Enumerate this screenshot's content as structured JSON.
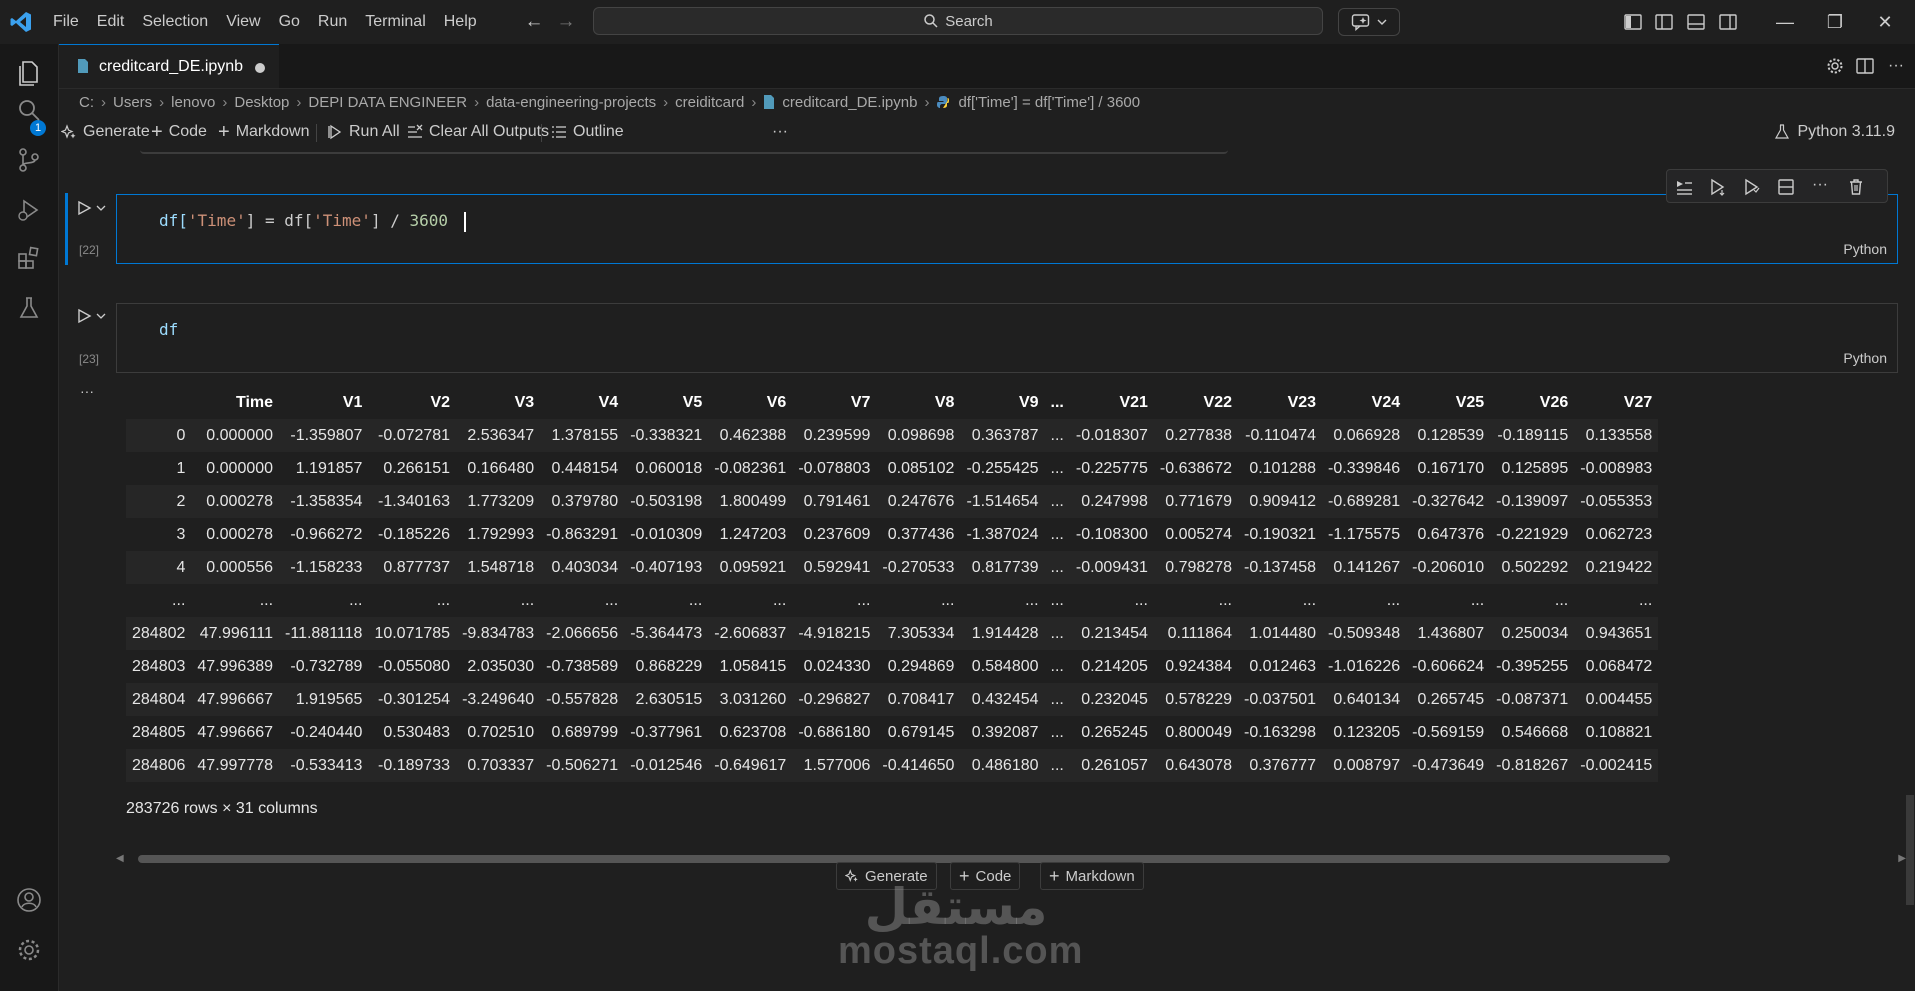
{
  "menu": [
    "File",
    "Edit",
    "Selection",
    "View",
    "Go",
    "Run",
    "Terminal",
    "Help"
  ],
  "search": {
    "label": "Search"
  },
  "accounts_badge": "1",
  "tab": {
    "title": "creditcard_DE.ipynb"
  },
  "breadcrumb": [
    "C:",
    "Users",
    "lenovo",
    "Desktop",
    "DEPI DATA ENGINEER",
    "data-engineering-projects",
    "creiditcard",
    "creditcard_DE.ipynb",
    "df['Time'] = df['Time'] / 3600"
  ],
  "toolbar": {
    "generate": "Generate",
    "code": "Code",
    "markdown": "Markdown",
    "run_all": "Run All",
    "clear_all": "Clear All Outputs",
    "outline": "Outline",
    "more": "···",
    "kernel": "Python 3.11.9"
  },
  "cells": [
    {
      "count": "[22]",
      "language": "Python"
    },
    {
      "count": "[23]",
      "language": "Python",
      "code": "df"
    }
  ],
  "code22": {
    "df": "df[",
    "s1": "'Time'",
    "eq": "] = df[",
    "s2": "'Time'",
    "tail": "] / ",
    "num": "3600"
  },
  "output": {
    "dots": "···",
    "columns": [
      "",
      "Time",
      "V1",
      "V2",
      "V3",
      "V4",
      "V5",
      "V6",
      "V7",
      "V8",
      "V9",
      "...",
      "V21",
      "V22",
      "V23",
      "V24",
      "V25",
      "V26",
      "V27"
    ],
    "rows": [
      [
        "0",
        "0.000000",
        "-1.359807",
        "-0.072781",
        "2.536347",
        "1.378155",
        "-0.338321",
        "0.462388",
        "0.239599",
        "0.098698",
        "0.363787",
        "...",
        "-0.018307",
        "0.277838",
        "-0.110474",
        "0.066928",
        "0.128539",
        "-0.189115",
        "0.133558"
      ],
      [
        "1",
        "0.000000",
        "1.191857",
        "0.266151",
        "0.166480",
        "0.448154",
        "0.060018",
        "-0.082361",
        "-0.078803",
        "0.085102",
        "-0.255425",
        "...",
        "-0.225775",
        "-0.638672",
        "0.101288",
        "-0.339846",
        "0.167170",
        "0.125895",
        "-0.008983"
      ],
      [
        "2",
        "0.000278",
        "-1.358354",
        "-1.340163",
        "1.773209",
        "0.379780",
        "-0.503198",
        "1.800499",
        "0.791461",
        "0.247676",
        "-1.514654",
        "...",
        "0.247998",
        "0.771679",
        "0.909412",
        "-0.689281",
        "-0.327642",
        "-0.139097",
        "-0.055353"
      ],
      [
        "3",
        "0.000278",
        "-0.966272",
        "-0.185226",
        "1.792993",
        "-0.863291",
        "-0.010309",
        "1.247203",
        "0.237609",
        "0.377436",
        "-1.387024",
        "...",
        "-0.108300",
        "0.005274",
        "-0.190321",
        "-1.175575",
        "0.647376",
        "-0.221929",
        "0.062723"
      ],
      [
        "4",
        "0.000556",
        "-1.158233",
        "0.877737",
        "1.548718",
        "0.403034",
        "-0.407193",
        "0.095921",
        "0.592941",
        "-0.270533",
        "0.817739",
        "...",
        "-0.009431",
        "0.798278",
        "-0.137458",
        "0.141267",
        "-0.206010",
        "0.502292",
        "0.219422"
      ],
      [
        "...",
        "...",
        "...",
        "...",
        "...",
        "...",
        "...",
        "...",
        "...",
        "...",
        "...",
        "...",
        "...",
        "...",
        "...",
        "...",
        "...",
        "...",
        "..."
      ],
      [
        "284802",
        "47.996111",
        "-11.881118",
        "10.071785",
        "-9.834783",
        "-2.066656",
        "-5.364473",
        "-2.606837",
        "-4.918215",
        "7.305334",
        "1.914428",
        "...",
        "0.213454",
        "0.111864",
        "1.014480",
        "-0.509348",
        "1.436807",
        "0.250034",
        "0.943651"
      ],
      [
        "284803",
        "47.996389",
        "-0.732789",
        "-0.055080",
        "2.035030",
        "-0.738589",
        "0.868229",
        "1.058415",
        "0.024330",
        "0.294869",
        "0.584800",
        "...",
        "0.214205",
        "0.924384",
        "0.012463",
        "-1.016226",
        "-0.606624",
        "-0.395255",
        "0.068472"
      ],
      [
        "284804",
        "47.996667",
        "1.919565",
        "-0.301254",
        "-3.249640",
        "-0.557828",
        "2.630515",
        "3.031260",
        "-0.296827",
        "0.708417",
        "0.432454",
        "...",
        "0.232045",
        "0.578229",
        "-0.037501",
        "0.640134",
        "0.265745",
        "-0.087371",
        "0.004455"
      ],
      [
        "284805",
        "47.996667",
        "-0.240440",
        "0.530483",
        "0.702510",
        "0.689799",
        "-0.377961",
        "0.623708",
        "-0.686180",
        "0.679145",
        "0.392087",
        "...",
        "0.265245",
        "0.800049",
        "-0.163298",
        "0.123205",
        "-0.569159",
        "0.546668",
        "0.108821"
      ],
      [
        "284806",
        "47.997778",
        "-0.533413",
        "-0.189733",
        "0.703337",
        "-0.506271",
        "-0.012546",
        "-0.649617",
        "1.577006",
        "-0.414650",
        "0.486180",
        "...",
        "0.261057",
        "0.643078",
        "0.376777",
        "0.008797",
        "-0.473649",
        "-0.818267",
        "-0.002415"
      ]
    ],
    "shape": "283726 rows × 31 columns"
  },
  "insert_bar": {
    "generate": "Generate",
    "code": "Code",
    "markdown": "Markdown"
  },
  "watermark": {
    "text": "mostaql.com",
    "logo_text": "مستقل"
  },
  "colors": {
    "accent": "#0078d4",
    "string": "#ce9178",
    "variable": "#9cdcfe",
    "number": "#b5cea8",
    "bracket": "#ffd700"
  }
}
